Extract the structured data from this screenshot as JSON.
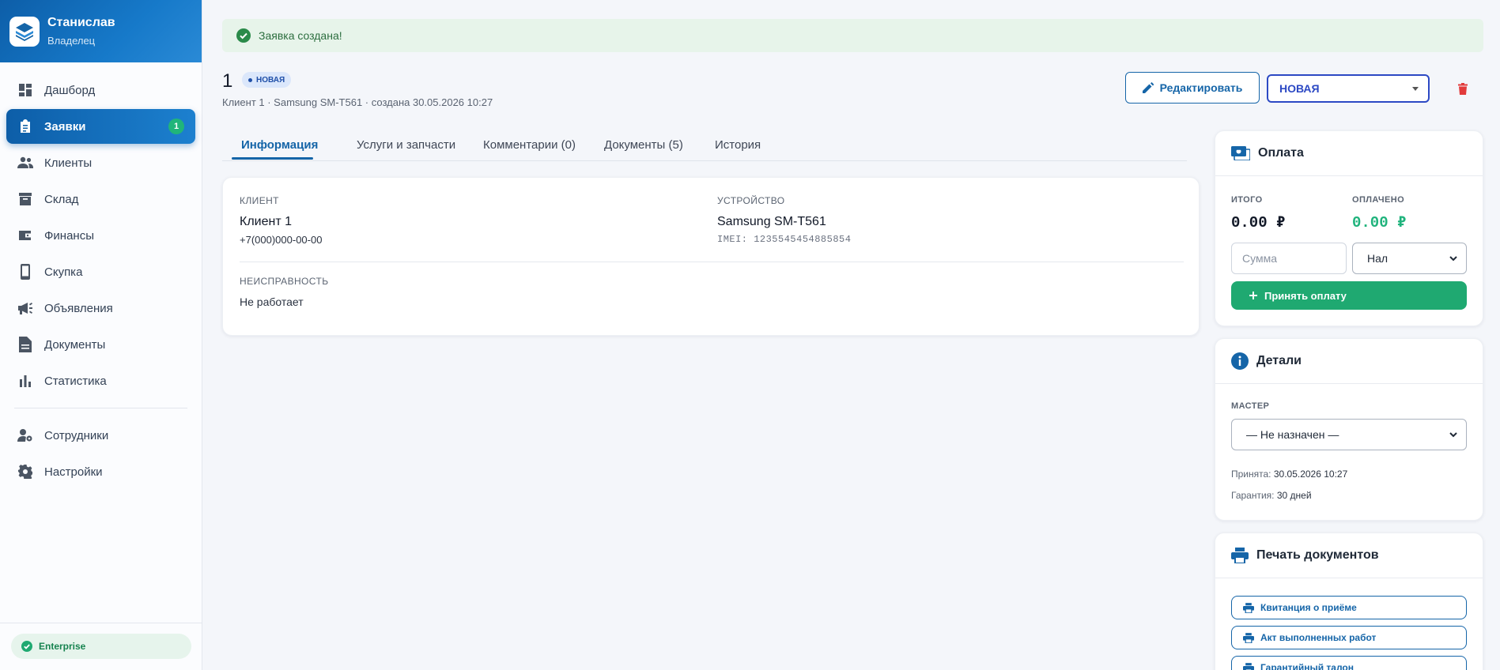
{
  "sidebar": {
    "user_name": "Станислав",
    "user_role": "Владелец",
    "items": [
      {
        "label": "Дашборд",
        "icon": "dashboard-icon"
      },
      {
        "label": "Заявки",
        "icon": "clipboard-icon",
        "badge": "1",
        "active": true
      },
      {
        "label": "Клиенты",
        "icon": "people-icon"
      },
      {
        "label": "Склад",
        "icon": "archive-box-icon"
      },
      {
        "label": "Финансы",
        "icon": "wallet-icon"
      },
      {
        "label": "Скупка",
        "icon": "phone-icon"
      },
      {
        "label": "Объявления",
        "icon": "megaphone-icon"
      },
      {
        "label": "Документы",
        "icon": "document-icon"
      },
      {
        "label": "Статистика",
        "icon": "bar-chart-icon"
      },
      {
        "label": "Сотрудники",
        "icon": "user-gear-icon"
      },
      {
        "label": "Настройки",
        "icon": "gear-icon"
      }
    ],
    "plan": "Enterprise"
  },
  "alert": {
    "text": "Заявка создана!"
  },
  "order": {
    "number": "1",
    "status_badge": "НОВАЯ",
    "meta": "Клиент 1 · Samsung SM-T561 · создана 30.05.2026 10:27"
  },
  "actions": {
    "edit_label": "Редактировать",
    "status_value": "НОВАЯ"
  },
  "tabs": [
    {
      "label": "Информация",
      "active": true
    },
    {
      "label": "Услуги и запчасти"
    },
    {
      "label": "Комментарии (0)"
    },
    {
      "label": "Документы (5)"
    },
    {
      "label": "История"
    }
  ],
  "info": {
    "client_label": "КЛИЕНТ",
    "client_name": "Клиент 1",
    "client_phone": "+7(000)000-00-00",
    "device_label": "УСТРОЙСТВО",
    "device_name": "Samsung SM-T561",
    "device_imei": "IMEI: 1235545454885854",
    "fault_label": "НЕИСПРАВНОСТЬ",
    "fault_value": "Не работает"
  },
  "payment": {
    "title": "Оплата",
    "total_label": "ИТОГО",
    "total_value": "0.00 ₽",
    "paid_label": "ОПЛАЧЕНО",
    "paid_value": "0.00 ₽",
    "amount_placeholder": "Сумма",
    "method_value": "Нал",
    "accept_label": "Принять оплату",
    "colors": {
      "paid": "#1fb37c",
      "accept": "#1fa971"
    }
  },
  "details": {
    "title": "Детали",
    "master_label": "МАСТЕР",
    "master_value": "— Не назначен —",
    "accepted_key": "Принята:",
    "accepted_value": "30.05.2026 10:27",
    "warranty_key": "Гарантия:",
    "warranty_value": "30 дней"
  },
  "print": {
    "title": "Печать документов",
    "docs": [
      "Квитанция о приёме",
      "Акт выполненных работ",
      "Гарантийный талон"
    ]
  },
  "colors": {
    "primary": "#1565a8",
    "danger": "#e23b3b",
    "status": "#2c49c4"
  }
}
